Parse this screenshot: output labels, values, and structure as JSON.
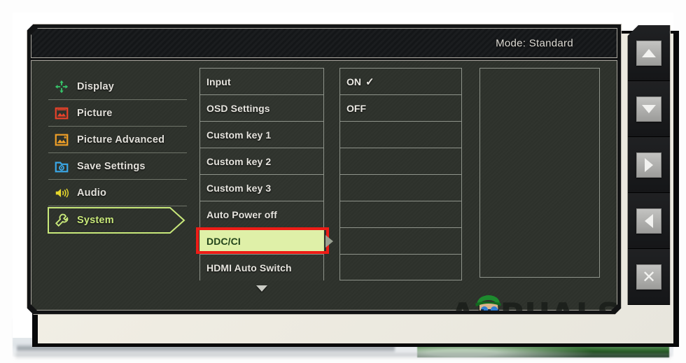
{
  "osd": {
    "title": "Mode: Standard",
    "sidebar": {
      "items": [
        {
          "label": "Display",
          "icon": "display-icon",
          "color": "#37c46a",
          "active": false
        },
        {
          "label": "Picture",
          "icon": "picture-icon",
          "color": "#e8422a",
          "active": false
        },
        {
          "label": "Picture Advanced",
          "icon": "picture-advanced-icon",
          "color": "#f0a028",
          "active": false
        },
        {
          "label": "Save Settings",
          "icon": "save-settings-icon",
          "color": "#3aa8e8",
          "active": false
        },
        {
          "label": "Audio",
          "icon": "audio-icon",
          "color": "#e4d52c",
          "active": false
        },
        {
          "label": "System",
          "icon": "system-wrench-icon",
          "color": "#c8e87a",
          "active": true
        }
      ]
    },
    "options": {
      "items": [
        {
          "label": "Input",
          "selected": false
        },
        {
          "label": "OSD Settings",
          "selected": false
        },
        {
          "label": "Custom key 1",
          "selected": false
        },
        {
          "label": "Custom key 2",
          "selected": false
        },
        {
          "label": "Custom key 3",
          "selected": false
        },
        {
          "label": "Auto Power off",
          "selected": false
        },
        {
          "label": "DDC/CI",
          "selected": true
        },
        {
          "label": "HDMI Auto Switch",
          "selected": false
        }
      ],
      "scroll_more_icon": "chevron-down-icon"
    },
    "values": {
      "items": [
        {
          "label": "ON",
          "checked": true,
          "check_glyph": "✓"
        },
        {
          "label": "OFF",
          "checked": false,
          "check_glyph": ""
        },
        {
          "label": "",
          "checked": false,
          "check_glyph": ""
        },
        {
          "label": "",
          "checked": false,
          "check_glyph": ""
        },
        {
          "label": "",
          "checked": false,
          "check_glyph": ""
        },
        {
          "label": "",
          "checked": false,
          "check_glyph": ""
        },
        {
          "label": "",
          "checked": false,
          "check_glyph": ""
        },
        {
          "label": "",
          "checked": false,
          "check_glyph": ""
        }
      ]
    },
    "colors": {
      "selected_row_bg": "#dff0a8",
      "selected_row_text": "#22431a",
      "annotation_border": "#ee1c16",
      "active_menu_text": "#c8e87a",
      "osd_background": "#2e322c"
    }
  },
  "monitor_buttons": [
    {
      "name": "up-button",
      "icon": "triangle-up-icon"
    },
    {
      "name": "down-button",
      "icon": "triangle-down-icon"
    },
    {
      "name": "right-button",
      "icon": "triangle-right-icon"
    },
    {
      "name": "left-button",
      "icon": "triangle-left-icon"
    },
    {
      "name": "close-button",
      "icon": "close-x-icon",
      "glyph": "✕"
    }
  ],
  "watermark": {
    "text": "APPUALS"
  }
}
